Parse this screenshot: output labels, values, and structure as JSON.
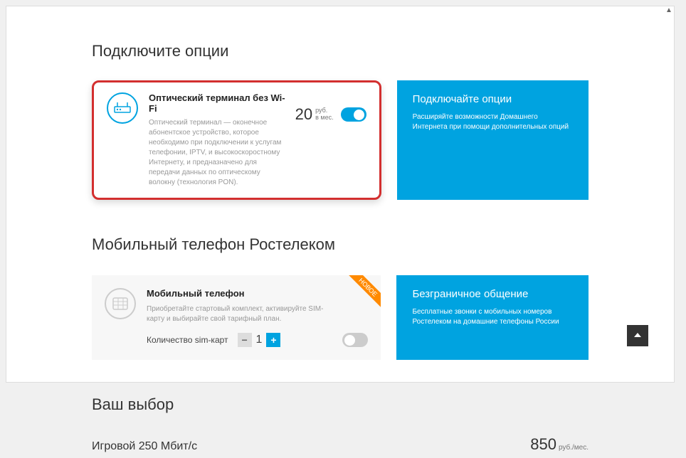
{
  "section1": {
    "title": "Подключите опции",
    "option": {
      "title": "Оптический терминал без Wi-Fi",
      "description": "Оптический терминал — оконечное абонентское устройство, которое необходимо при подключении к услугам телефонии, IPTV, и высокоскоростному Интернету, и предназначено для передачи данных по оптическому волокну (технология PON).",
      "price_value": "20",
      "price_unit_top": "руб.",
      "price_unit_bottom": "в мес."
    },
    "promo": {
      "title": "Подключайте опции",
      "text": "Расширяйте возможности Домашнего Интернета при помощи дополнительных опций"
    }
  },
  "section2": {
    "title": "Мобильный телефон Ростелеком",
    "option": {
      "title": "Мобильный телефон",
      "description": "Приобретайте стартовый комплект, активируйте SIM-карту и выбирайте свой тарифный план.",
      "sim_label": "Количество sim-карт",
      "sim_value": "1",
      "badge": "НОВОЕ"
    },
    "promo": {
      "title": "Безграничное общение",
      "text": "Бесплатные звонки с мобильных номеров Ростелеком на домашние телефоны России"
    }
  },
  "section3": {
    "title": "Ваш выбор",
    "item": {
      "name": "Игровой 250 Мбит/с",
      "price": "850",
      "unit": "руб./мес."
    }
  }
}
